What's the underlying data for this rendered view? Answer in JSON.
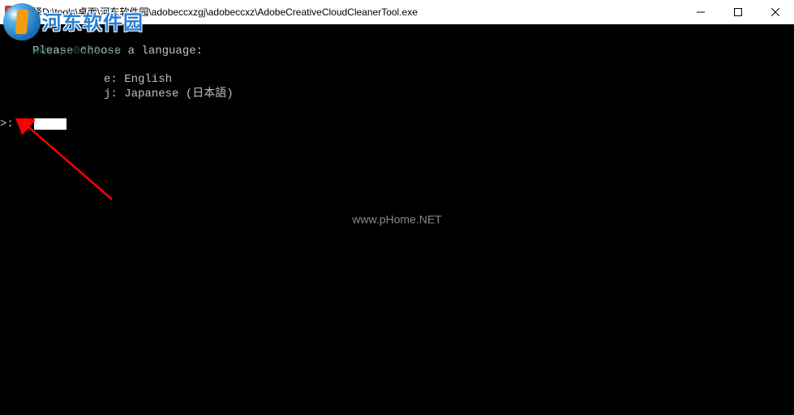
{
  "window": {
    "title": "选择D:\\tools\\桌面\\河东软件园\\adobeccxzgj\\adobeccxz\\AdobeCreativeCloudCleanerTool.exe"
  },
  "console": {
    "prompt_line": "Please choose a language:",
    "ghost_overlay": "www.pc0359.cn",
    "option_e": "e: English",
    "option_j": "j: Japanese (日本語)",
    "input_prefix": ">: ",
    "input_value": "e"
  },
  "watermark": {
    "logo_text": "河东软件园",
    "center_text": "www.pHome.NET"
  }
}
